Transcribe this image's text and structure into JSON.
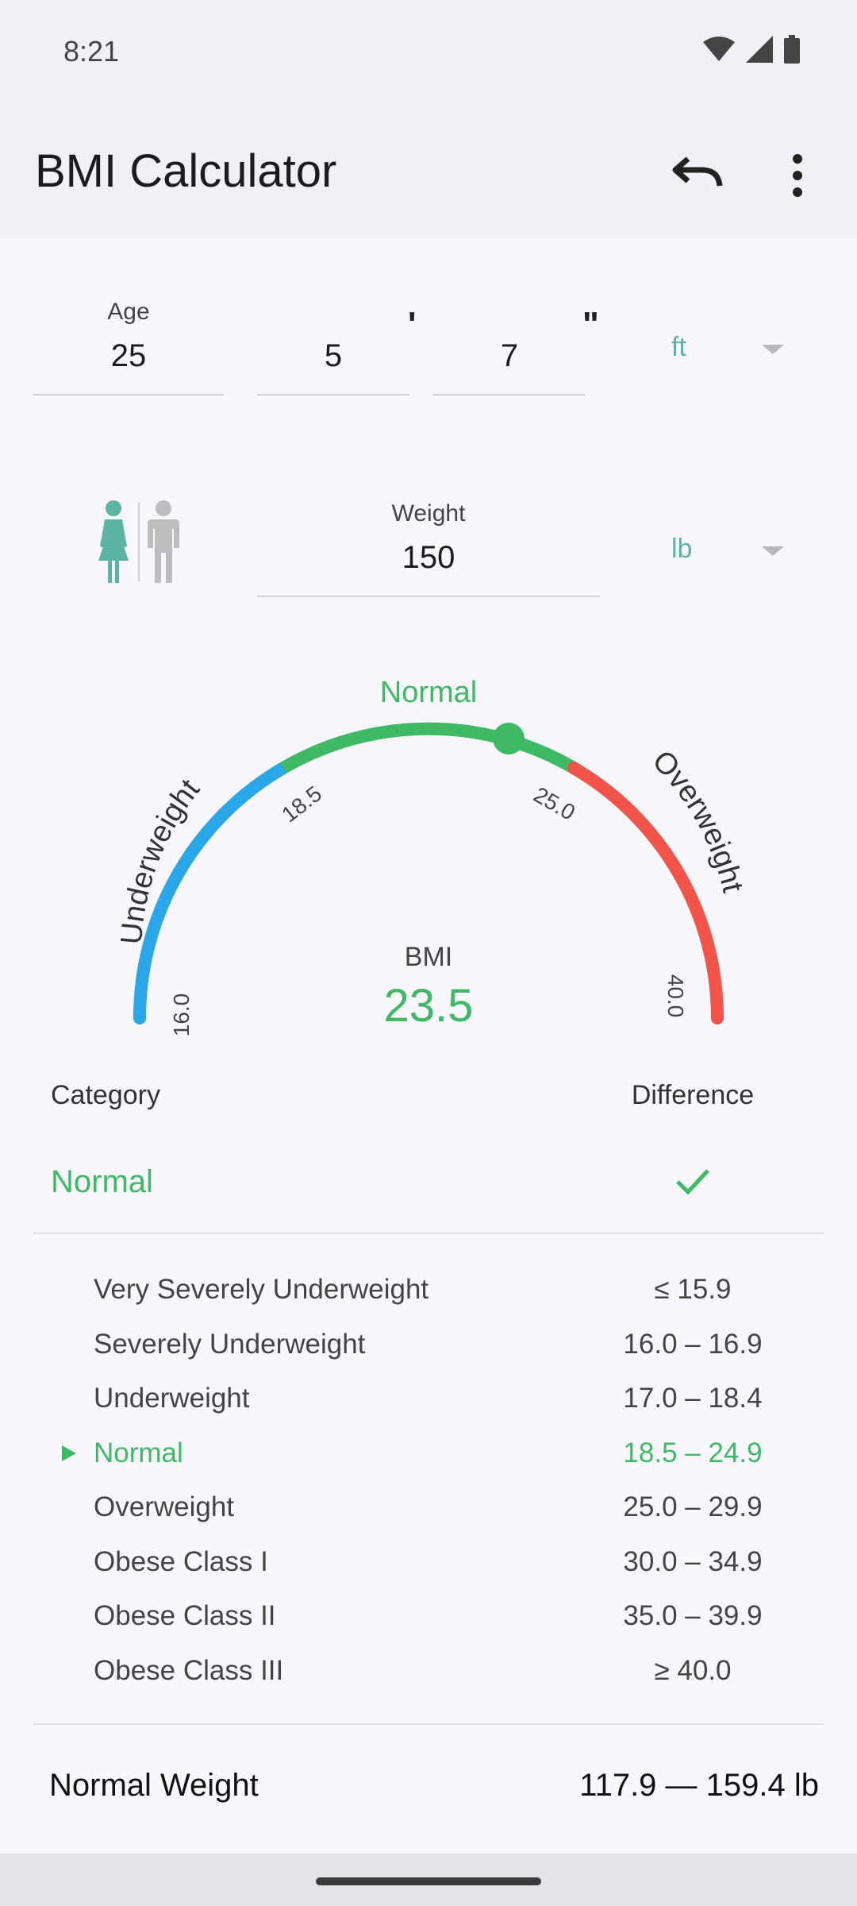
{
  "status_bar": {
    "time": "8:21"
  },
  "app": {
    "title": "BMI Calculator"
  },
  "inputs": {
    "age_label": "Age",
    "age_value": "25",
    "height_feet": "5",
    "feet_mark": "'",
    "height_inches": "7",
    "inch_mark": "\"",
    "height_unit": "ft",
    "weight_label": "Weight",
    "weight_value": "150",
    "weight_unit": "lb"
  },
  "gauge": {
    "labels": {
      "left": "Underweight",
      "top": "Normal",
      "right": "Overweight"
    },
    "ticks": [
      "16.0",
      "18.5",
      "25.0",
      "40.0"
    ],
    "bmi_label": "BMI",
    "bmi_value": "23.5",
    "min": 16.0,
    "max": 40.0,
    "current": 23.5,
    "colors": {
      "underweight": "#29a7e8",
      "normal": "#3dba63",
      "overweight": "#f25449"
    }
  },
  "category": {
    "header_category": "Category",
    "header_difference": "Difference",
    "current": "Normal"
  },
  "table": [
    {
      "name": "Very Severely Underweight",
      "range": "≤ 15.9"
    },
    {
      "name": "Severely Underweight",
      "range": "16.0 – 16.9"
    },
    {
      "name": "Underweight",
      "range": "17.0 – 18.4"
    },
    {
      "name": "Normal",
      "range": "18.5 – 24.9",
      "active": true
    },
    {
      "name": "Overweight",
      "range": "25.0 – 29.9"
    },
    {
      "name": "Obese Class I",
      "range": "30.0 – 34.9"
    },
    {
      "name": "Obese Class II",
      "range": "35.0 – 39.9"
    },
    {
      "name": "Obese Class III",
      "range": "≥ 40.0"
    }
  ],
  "footer": {
    "label": "Normal Weight",
    "value": "117.9 — 159.4 lb"
  },
  "colors": {
    "accent": "#3dba63",
    "teal": "#5bb5a2"
  },
  "icons": [
    "wifi-icon",
    "signal-icon",
    "battery-icon",
    "undo-icon",
    "more-vert-icon",
    "female-icon",
    "male-icon",
    "dropdown-arrow-icon",
    "check-icon"
  ]
}
